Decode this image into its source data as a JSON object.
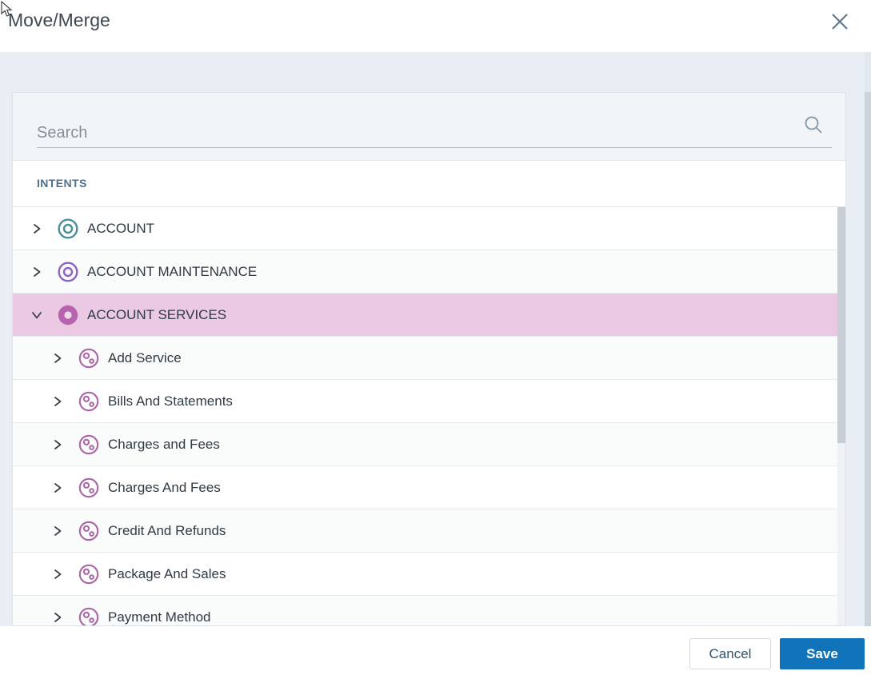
{
  "window": {
    "title": "Move/Merge"
  },
  "search": {
    "placeholder": "Search"
  },
  "list_header": "INTENTS",
  "tree": {
    "items": [
      {
        "label": "ACCOUNT",
        "level": 1,
        "expanded": false,
        "selected": false,
        "icon": "intent-circle-icon",
        "icon_color": "#4d8d98"
      },
      {
        "label": "ACCOUNT MAINTENANCE",
        "level": 1,
        "expanded": false,
        "selected": false,
        "icon": "intent-circle-icon",
        "icon_color": "#8e63c5"
      },
      {
        "label": "ACCOUNT SERVICES",
        "level": 1,
        "expanded": true,
        "selected": true,
        "icon": "intent-circle-filled-icon",
        "icon_color": "#b763ae"
      },
      {
        "label": "Add Service",
        "level": 2,
        "expanded": false,
        "selected": false,
        "icon": "sub-intent-icon",
        "icon_color": "#ad63a7"
      },
      {
        "label": "Bills And Statements",
        "level": 2,
        "expanded": false,
        "selected": false,
        "icon": "sub-intent-icon",
        "icon_color": "#ad63a7"
      },
      {
        "label": "Charges and Fees",
        "level": 2,
        "expanded": false,
        "selected": false,
        "icon": "sub-intent-icon",
        "icon_color": "#ad63a7"
      },
      {
        "label": "Charges And Fees",
        "level": 2,
        "expanded": false,
        "selected": false,
        "icon": "sub-intent-icon",
        "icon_color": "#ad63a7"
      },
      {
        "label": "Credit And Refunds",
        "level": 2,
        "expanded": false,
        "selected": false,
        "icon": "sub-intent-icon",
        "icon_color": "#ad63a7"
      },
      {
        "label": "Package And Sales",
        "level": 2,
        "expanded": false,
        "selected": false,
        "icon": "sub-intent-icon",
        "icon_color": "#ad63a7"
      },
      {
        "label": "Payment Method",
        "level": 2,
        "expanded": false,
        "selected": false,
        "icon": "sub-intent-icon",
        "icon_color": "#ad63a7"
      }
    ]
  },
  "footer": {
    "cancel_label": "Cancel",
    "save_label": "Save"
  },
  "colors": {
    "accent": "#1174ba",
    "selected_row": "#ebc9e5"
  }
}
